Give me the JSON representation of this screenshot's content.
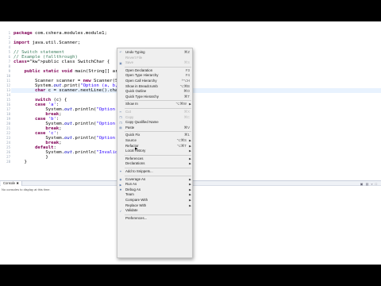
{
  "editor": {
    "line_numbers": [
      "1",
      "2",
      "3",
      "4",
      "5",
      "6",
      "7",
      "8",
      "9",
      "10",
      "11",
      "12",
      "13",
      "14",
      "15",
      "16",
      "17",
      "18",
      "19",
      "20",
      "21",
      "22",
      "23",
      "24",
      "25",
      "26",
      "27",
      "28"
    ],
    "lines": [
      {
        "t": "package com.cshera.modules.module1;",
        "k": [
          "package"
        ]
      },
      {
        "t": ""
      },
      {
        "t": "import java.util.Scanner;",
        "k": [
          "import"
        ]
      },
      {
        "t": ""
      },
      {
        "t": "// Switch statement",
        "c": true
      },
      {
        "t": "// Example (fallthrough)",
        "c": true
      },
      {
        "t": "public class SwitchChar {",
        "k": [
          "public",
          "class"
        ]
      },
      {
        "t": ""
      },
      {
        "t": "    public static void main(String[] args",
        "k": [
          "public",
          "static",
          "void"
        ]
      },
      {
        "t": ""
      },
      {
        "t": "        Scanner scanner = new Scanner(Sys",
        "k": [
          "new"
        ]
      },
      {
        "t": "        System.out.print(\"Option (a, b,",
        "f": "out"
      },
      {
        "t": "        char c = scanner.nextLine().charA",
        "k": [
          "char"
        ]
      },
      {
        "t": ""
      },
      {
        "t": "        switch (c) {",
        "k": [
          "switch"
        ]
      },
      {
        "t": "        case 'a':",
        "k": [
          "case"
        ]
      },
      {
        "t": "            System.out.println(\"Option A",
        "f": "out"
      },
      {
        "t": "            break;",
        "k": [
          "break"
        ]
      },
      {
        "t": "        case 'b':",
        "k": [
          "case"
        ]
      },
      {
        "t": "            System.out.println(\"Option B",
        "f": "out"
      },
      {
        "t": "            break;",
        "k": [
          "break"
        ]
      },
      {
        "t": "        case 'c':",
        "k": [
          "case"
        ]
      },
      {
        "t": "            System.out.println(\"Option C",
        "f": "out"
      },
      {
        "t": "            break;",
        "k": [
          "break"
        ]
      },
      {
        "t": "        default:",
        "k": [
          "default"
        ]
      },
      {
        "t": "            System.out.println(\"Invalid o",
        "f": "out"
      },
      {
        "t": "            }"
      },
      {
        "t": "    }"
      }
    ]
  },
  "console": {
    "tab_label": "Console ✖",
    "message": "No consoles to display at this time.",
    "toolbar_icons": "▣ ▤ ▿ □"
  },
  "menu": {
    "items": [
      {
        "label": "Undo Typing",
        "shortcut": "⌘Z",
        "icon": "↶",
        "icon_name": "undo-icon"
      },
      {
        "label": "Revert File",
        "disabled": true
      },
      {
        "label": "Save",
        "shortcut": "⌘S",
        "disabled": true,
        "icon": "▣",
        "icon_name": "save-icon"
      },
      {
        "sep": true
      },
      {
        "label": "Open Declaration",
        "shortcut": "F3"
      },
      {
        "label": "Open Type Hierarchy",
        "shortcut": "F4"
      },
      {
        "label": "Open Call Hierarchy",
        "shortcut": "^⌥H"
      },
      {
        "label": "Show in Breadcrumb",
        "shortcut": "⌥⌘B"
      },
      {
        "label": "Quick Outline",
        "shortcut": "⌘O"
      },
      {
        "label": "Quick Type Hierarchy",
        "shortcut": "⌘T"
      },
      {
        "sep": true
      },
      {
        "label": "Show In",
        "shortcut": "⌥⌘W",
        "submenu": true
      },
      {
        "sep": true
      },
      {
        "label": "Cut",
        "shortcut": "⌘X",
        "disabled": true,
        "icon": "✂",
        "icon_name": "cut-icon"
      },
      {
        "label": "Copy",
        "shortcut": "⌘C",
        "disabled": true,
        "icon": "❐",
        "icon_name": "copy-icon"
      },
      {
        "label": "Copy Qualified Name",
        "icon": "❐",
        "icon_name": "copy-qualified-name-icon"
      },
      {
        "label": "Paste",
        "shortcut": "⌘V",
        "icon": "▤",
        "icon_name": "paste-icon"
      },
      {
        "sep": true
      },
      {
        "label": "Quick Fix",
        "shortcut": "⌘1"
      },
      {
        "label": "Source",
        "shortcut": "⌥⌘S",
        "submenu": true
      },
      {
        "label": "Refactor",
        "shortcut": "⌥⌘T",
        "submenu": true
      },
      {
        "label": "Local History",
        "submenu": true
      },
      {
        "sep": true
      },
      {
        "label": "References",
        "submenu": true
      },
      {
        "label": "Declarations",
        "submenu": true
      },
      {
        "sep": true
      },
      {
        "label": "Add to Snippets...",
        "icon": "✦",
        "icon_name": "snippets-icon"
      },
      {
        "sep": true
      },
      {
        "label": "Coverage As",
        "submenu": true,
        "icon": "◉",
        "icon_name": "coverage-icon"
      },
      {
        "label": "Run As",
        "submenu": true,
        "icon": "▶",
        "icon_name": "run-icon"
      },
      {
        "label": "Debug As",
        "submenu": true,
        "icon": "✸",
        "icon_name": "debug-icon"
      },
      {
        "label": "Team",
        "submenu": true
      },
      {
        "label": "Compare With",
        "submenu": true
      },
      {
        "label": "Replace With",
        "submenu": true
      },
      {
        "label": "Validate",
        "icon": "✓",
        "icon_name": "validate-icon"
      },
      {
        "sep": true
      },
      {
        "label": "Preferences..."
      }
    ]
  }
}
